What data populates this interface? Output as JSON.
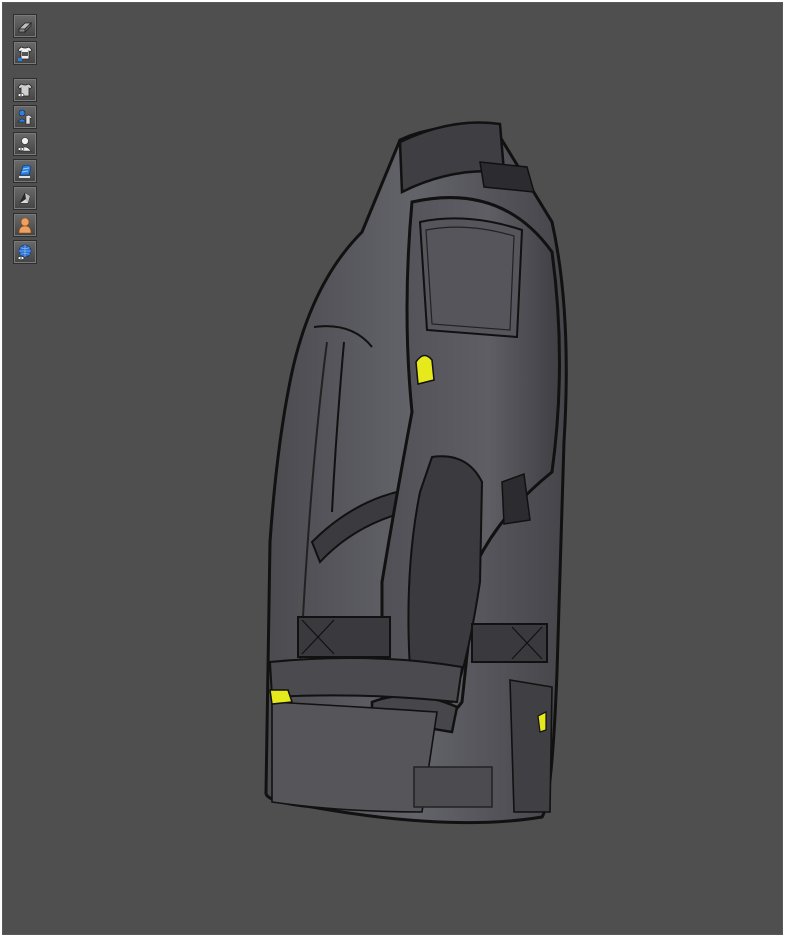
{
  "viewport": {
    "background": "#4f4f4f"
  },
  "toolbar": {
    "groups": [
      [
        {
          "icon": "avatar-display-icon",
          "tooltip": ""
        },
        {
          "icon": "garment-texture-icon",
          "tooltip": ""
        }
      ],
      [
        {
          "icon": "show-garment-icon",
          "tooltip": ""
        },
        {
          "icon": "show-avatar-garment-icon",
          "tooltip": ""
        },
        {
          "icon": "show-avatar-icon",
          "tooltip": ""
        },
        {
          "icon": "surface-view-icon",
          "tooltip": ""
        },
        {
          "icon": "shading-icon",
          "tooltip": ""
        },
        {
          "icon": "avatar-skin-icon",
          "tooltip": ""
        },
        {
          "icon": "environment-globe-icon",
          "tooltip": ""
        }
      ]
    ]
  },
  "colors": {
    "jacket_body": "#5b5b60",
    "jacket_dark": "#3e3e42",
    "outline": "#111111",
    "accent_yellow": "#e6ea1c",
    "icon_blue": "#2f7fe0",
    "icon_skin": "#f0a060"
  }
}
